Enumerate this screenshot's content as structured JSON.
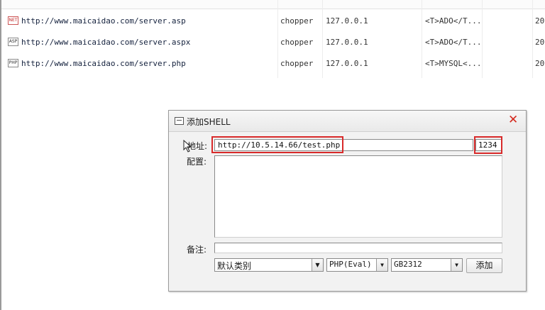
{
  "shell_list": {
    "rows": [
      {
        "icon": "NET",
        "url": "http://www.maicaidao.com/server.asp",
        "type": "chopper",
        "ip": "127.0.0.1",
        "config": "<T>ADO</T...",
        "time": "20"
      },
      {
        "icon": "ASP",
        "url": "http://www.maicaidao.com/server.aspx",
        "type": "chopper",
        "ip": "127.0.0.1",
        "config": "<T>ADO</T...",
        "time": "20"
      },
      {
        "icon": "PHP",
        "url": "http://www.maicaidao.com/server.php",
        "type": "chopper",
        "ip": "127.0.0.1",
        "config": "<T>MYSQL<...",
        "time": "20"
      }
    ]
  },
  "dialog": {
    "title": "添加SHELL",
    "address_label": "地址:",
    "url_value": "http://10.5.14.66/test.php",
    "password_value": "1234",
    "config_label": "配置:",
    "note_label": "备注:",
    "category_select": "默认类别",
    "script_type_select": "PHP(Eval)",
    "encoding_select": "GB2312",
    "add_button": "添加"
  },
  "colors": {
    "highlight": "#d82a2a",
    "close": "#d42a1f"
  }
}
